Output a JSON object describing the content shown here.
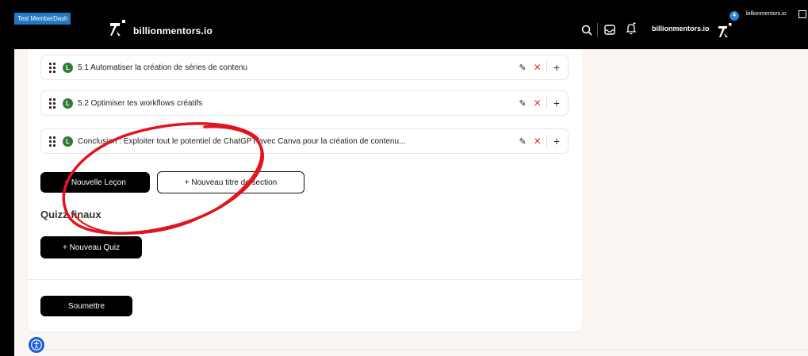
{
  "topbar": {
    "tag": "Test MemberDash",
    "logo_text": "billionmentors.io",
    "brand_label": "billionmentors.io",
    "notification_count": "4",
    "brand_small": "billionmentors.io"
  },
  "lessons": [
    {
      "badge": "L",
      "title": "5.1 Automatiser la création de séries de contenu"
    },
    {
      "badge": "L",
      "title": "5.2 Optimiser tes workflows créatifs"
    },
    {
      "badge": "L",
      "title": "Conclusion : Exploiter tout le potentiel de ChatGPT avec Canva pour la création de contenu..."
    }
  ],
  "buttons": {
    "new_lesson": "+ Nouvelle Leçon",
    "new_section_title": "+ Nouveau titre de section",
    "new_quiz": "+ Nouveau Quiz",
    "submit": "Soumettre"
  },
  "quiz_section_title": "Quizz finaux",
  "colors": {
    "annotation_red": "#e0141e",
    "badge_green": "#2f7d32",
    "delete_red": "#e53935",
    "topbar": "#000000",
    "page_bg": "#fbf6f1"
  }
}
